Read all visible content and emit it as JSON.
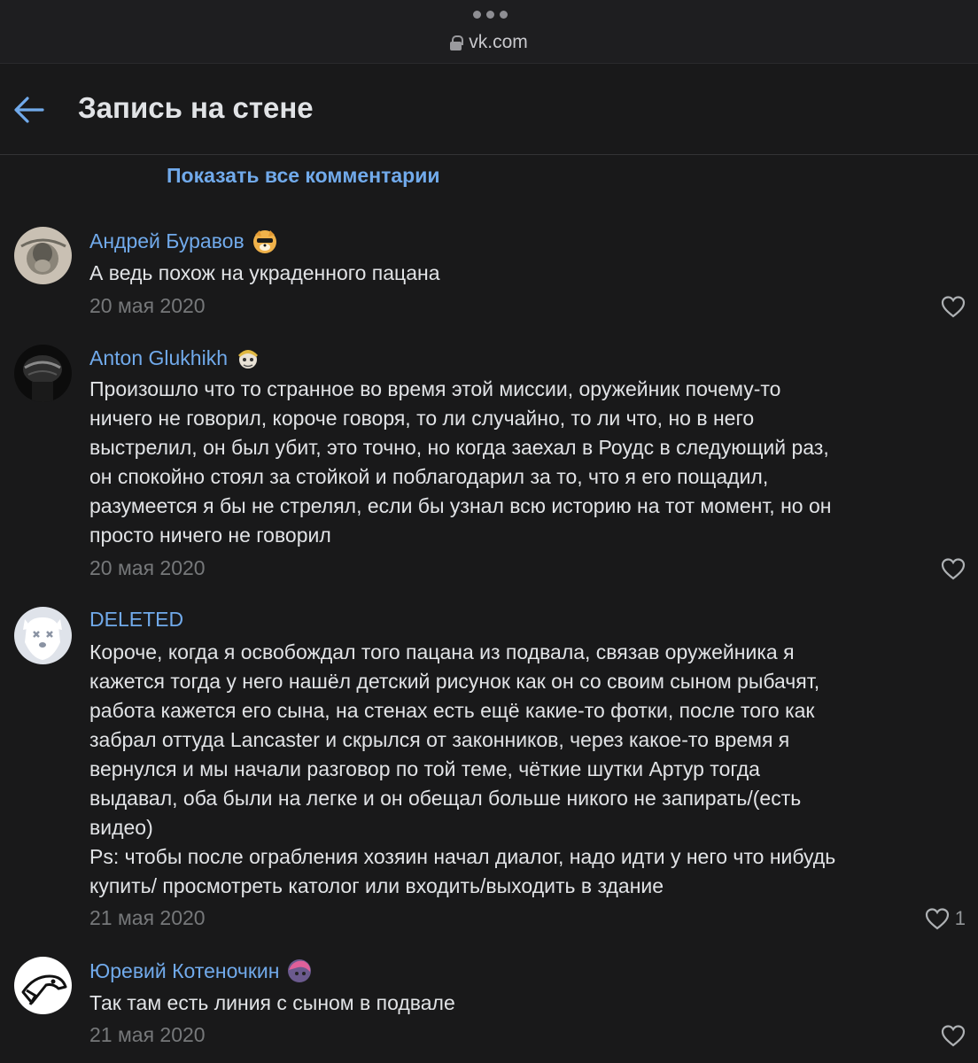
{
  "browser": {
    "url": "vk.com"
  },
  "header": {
    "title": "Запись на стене"
  },
  "show_all_comments": "Показать все комментарии",
  "comments": [
    {
      "author": "Андрей Буравов",
      "text": "А ведь похож на украденного пацана",
      "date": "20 мая 2020",
      "likes": ""
    },
    {
      "author": "Anton Glukhikh",
      "text": "Произошло что то странное во время этой миссии, оружейник почему-то\nничего не говорил, короче говоря, то ли случайно, то ли что, но в него\nвыстрелил, он был убит, это точно, но когда заехал в Роудс в следующий раз,\nон спокойно стоял за стойкой и поблагодарил за то, что я его пощадил,\nразумеется я бы не стрелял, если бы узнал всю историю на тот момент, но он\nпросто ничего не говорил",
      "date": "20 мая 2020",
      "likes": ""
    },
    {
      "author": "DELETED",
      "text": "Короче, когда я освобождал того пацана из подвала, связав оружейника я\nкажется тогда у него нашёл детский рисунок как он со своим сыном рыбачят,\nработа кажется его сына, на стенах есть ещё какие-то фотки, после того как\nзабрал оттуда Lancaster и скрылся от законников, через какое-то время я\nвернулся и мы начали разговор по той теме, чёткие шутки Артур тогда\nвыдавал, оба были на легке и он обещал больше никого не запирать/(есть\nвидео)\nPs: чтобы после ограбления хозяин начал диалог, надо идти у него что нибудь\nкупить/ просмотреть католог или входить/выходить в здание",
      "date": "21 мая 2020",
      "likes": "1"
    },
    {
      "author": "Юревий Котеночкин",
      "text": "Так там есть линия с сыном в подвале",
      "date": "21 мая 2020",
      "likes": ""
    }
  ],
  "colors": {
    "background": "#19191a",
    "link": "#71aaeb",
    "text": "#e1e3e6",
    "secondary": "#76787a"
  }
}
